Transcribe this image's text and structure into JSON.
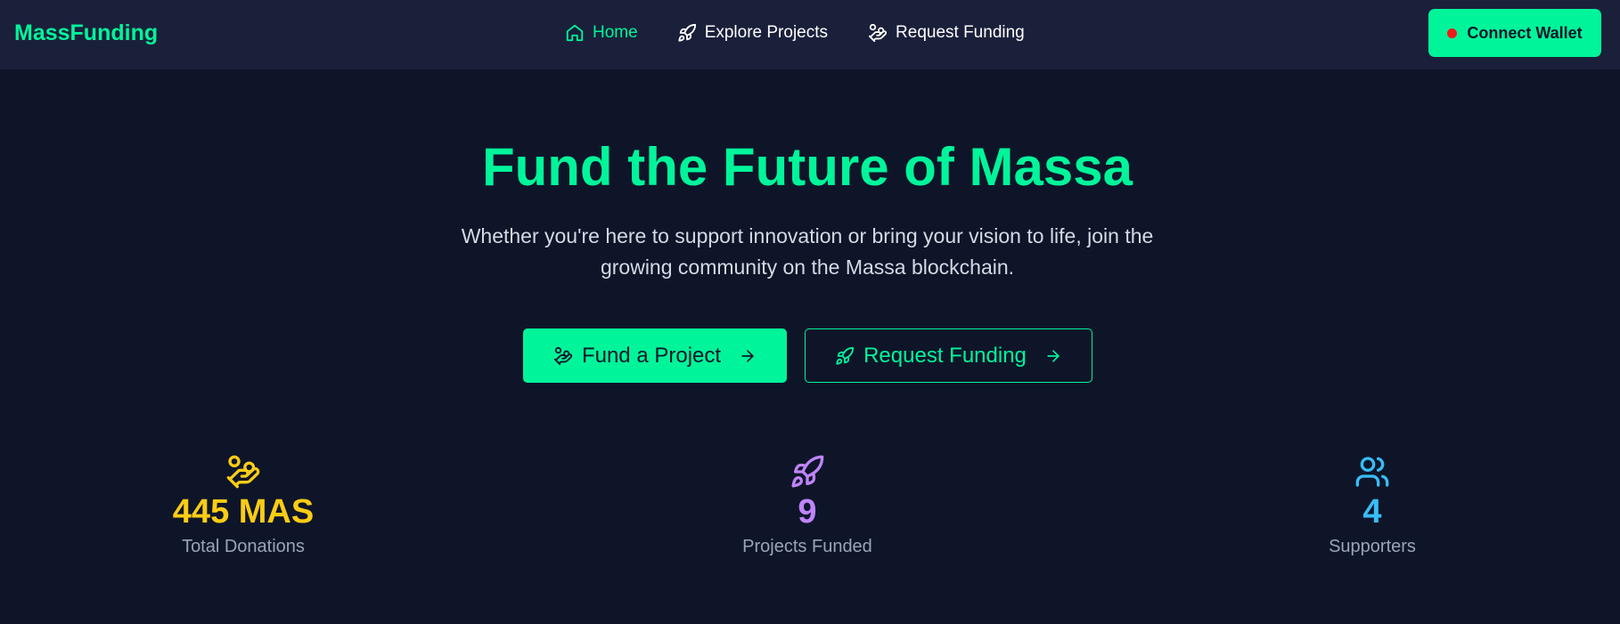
{
  "brand": "MassFunding",
  "nav": {
    "items": [
      {
        "label": "Home",
        "icon": "home-icon",
        "active": true
      },
      {
        "label": "Explore Projects",
        "icon": "rocket-icon"
      },
      {
        "label": "Request Funding",
        "icon": "hand-coins-icon"
      }
    ]
  },
  "wallet": {
    "label": "Connect Wallet",
    "status_color": "#ef1a1a"
  },
  "hero": {
    "title": "Fund the Future of Massa",
    "subtitle": "Whether you're here to support innovation or bring your vision to life, join the growing community on the Massa blockchain."
  },
  "actions": {
    "fund_label": "Fund a Project",
    "request_label": "Request Funding"
  },
  "stats": [
    {
      "value": "445 MAS",
      "label": "Total Donations",
      "icon": "hand-coins-icon",
      "color": "#facc15"
    },
    {
      "value": "9",
      "label": "Projects Funded",
      "icon": "rocket-icon",
      "color": "#c084fc"
    },
    {
      "value": "4",
      "label": "Supporters",
      "icon": "users-icon",
      "color": "#38bdf8"
    }
  ],
  "colors": {
    "accent": "#00f59a",
    "background": "#0e1529",
    "navbar": "#1a203a"
  }
}
